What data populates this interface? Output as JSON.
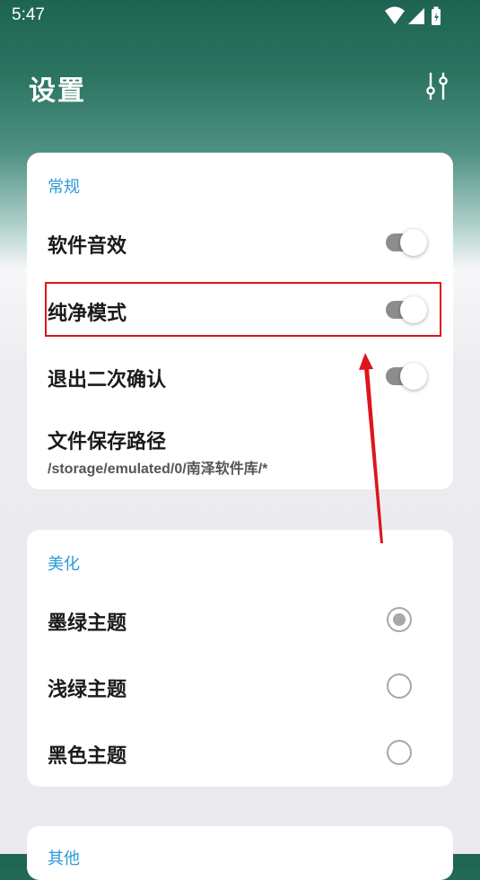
{
  "status_bar": {
    "time": "5:47"
  },
  "header": {
    "title": "设置",
    "tune_icon": "tune-sliders-icon"
  },
  "general": {
    "title": "常规",
    "items": [
      {
        "label": "软件音效",
        "enabled": true
      },
      {
        "label": "纯净模式",
        "enabled": true
      },
      {
        "label": "退出二次确认",
        "enabled": true
      }
    ],
    "save_path": {
      "label": "文件保存路径",
      "value": "/storage/emulated/0/南泽软件库/*"
    }
  },
  "theme": {
    "title": "美化",
    "options": [
      {
        "label": "墨绿主题",
        "selected": true
      },
      {
        "label": "浅绿主题",
        "selected": false
      },
      {
        "label": "黑色主题",
        "selected": false
      }
    ]
  },
  "other": {
    "title": "其他"
  },
  "colors": {
    "accent": "#2b9ad8",
    "highlight": "#e0141c",
    "header_green": "#1f6452"
  }
}
